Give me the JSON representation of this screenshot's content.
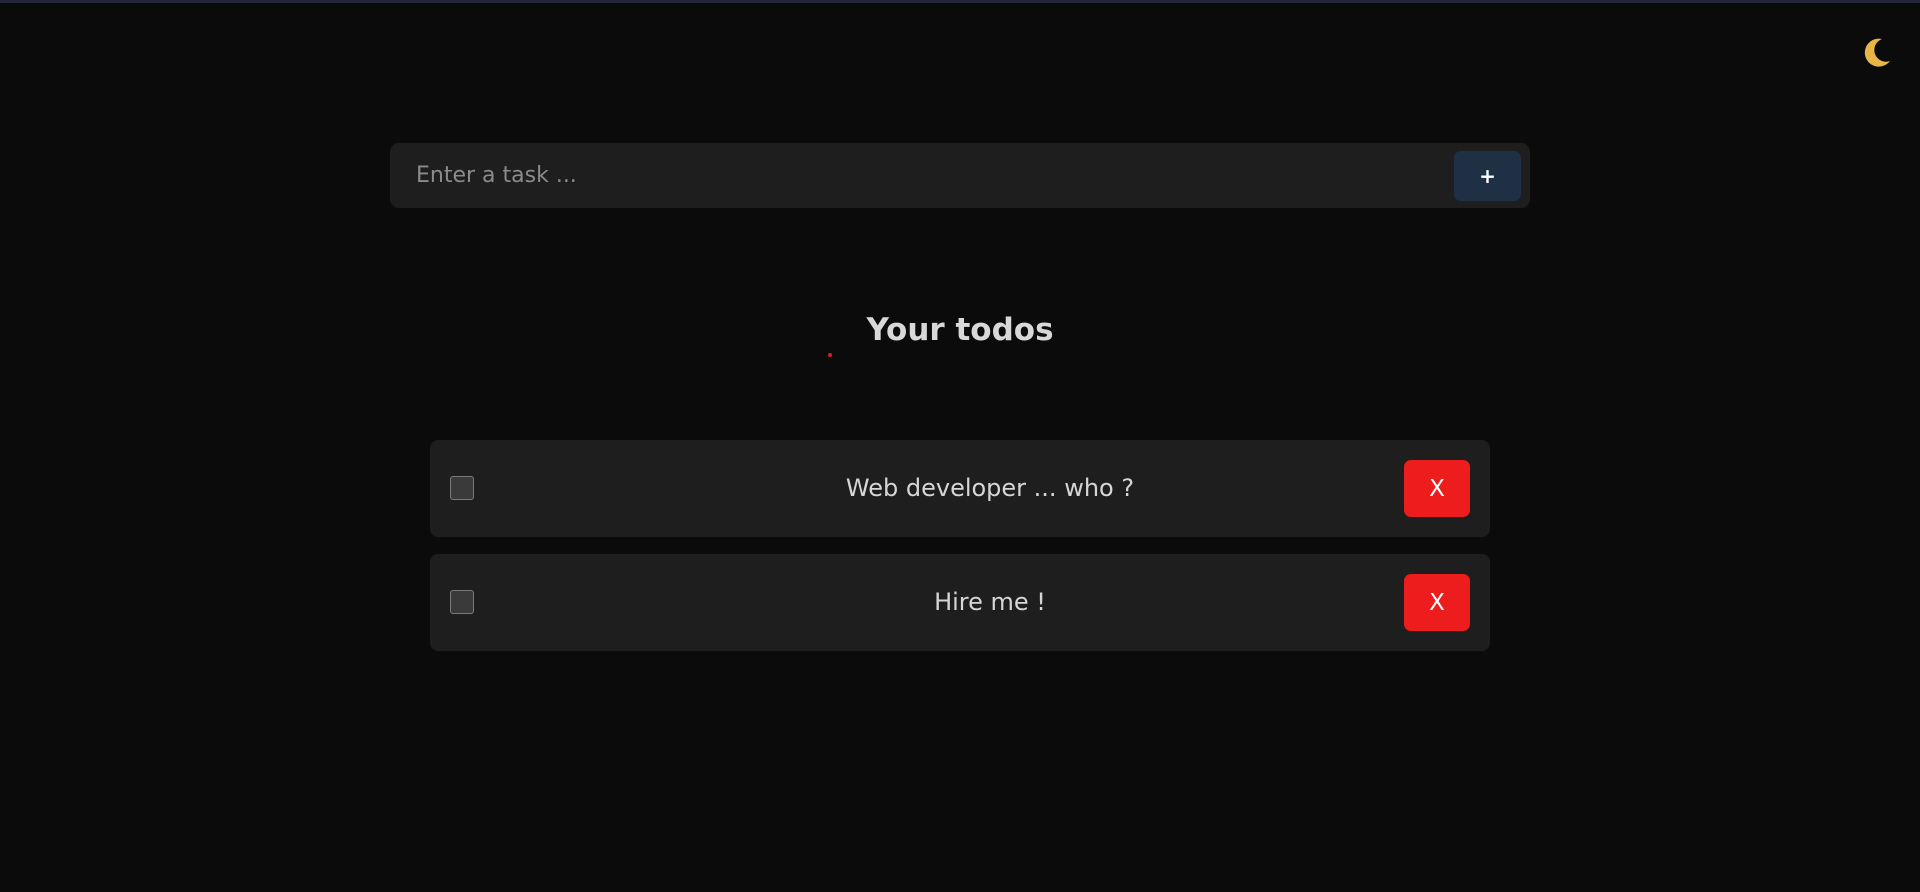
{
  "theme_toggle": {
    "icon": "moon-icon",
    "glyph": "🌙"
  },
  "task_input": {
    "placeholder": "Enter a task ...",
    "value": ""
  },
  "add_button": {
    "label": "+"
  },
  "title": "Your todos",
  "todos": [
    {
      "text": "Web developer ... who ?",
      "checked": false,
      "delete_label": "X"
    },
    {
      "text": "Hire me !",
      "checked": false,
      "delete_label": "X"
    }
  ],
  "colors": {
    "background": "#0b0b0b",
    "surface": "#1e1e1e",
    "add_button": "#1f2f44",
    "delete_button": "#ee1d1d",
    "moon": "#e8b547"
  }
}
